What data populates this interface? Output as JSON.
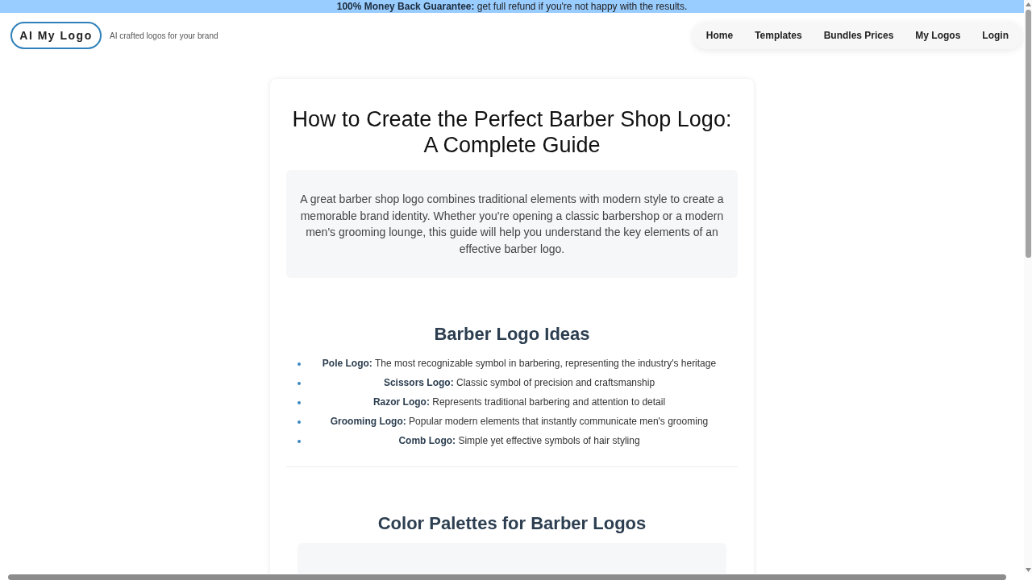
{
  "banner": {
    "message": "**100% Money Back Guarantee:** get full refund if you're not happy with the results."
  },
  "header": {
    "logo": "AI My Logo",
    "tagline": "AI crafted logos for your brand",
    "nav": [
      "Home",
      "Templates",
      "Bundles Prices",
      "My Logos",
      "Login"
    ]
  },
  "article": {
    "title": "How to Create the Perfect Barber Shop Logo: A Complete Guide",
    "intro": "A great barber shop logo combines traditional elements with modern style to create a memorable brand identity. Whether you're opening a classic barbershop or a modern men's grooming lounge, this guide will help you understand the key elements of an effective barber logo.",
    "sections": [
      {
        "kind": "list",
        "heading": "Barber Logo Ideas",
        "items": [
          "**Pole Logo:** The most recognizable symbol in barbering, representing the industry's heritage",
          "**Scissors Logo:** Classic symbol of precision and craftsmanship",
          "**Razor Logo:** Represents traditional barbering and attention to detail",
          "**Grooming Logo:** Popular modern elements that instantly communicate men's grooming",
          "**Comb Logo:** Simple yet effective symbols of hair styling"
        ]
      },
      {
        "kind": "panel",
        "heading": "Color Palettes for Barber Logos"
      }
    ]
  }
}
